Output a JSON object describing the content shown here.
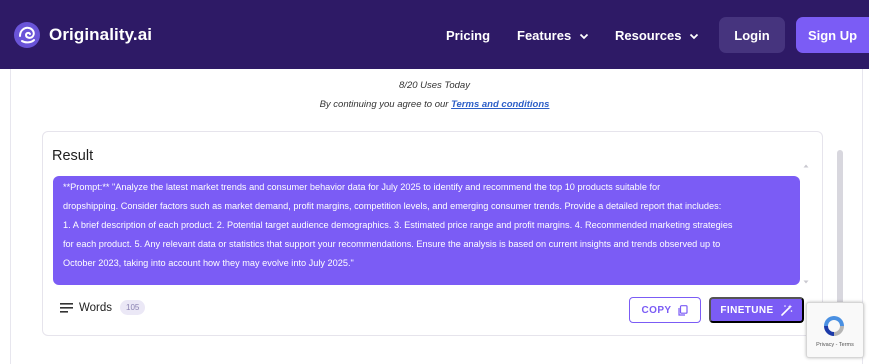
{
  "nav": {
    "brand": "Originality.ai",
    "links": [
      {
        "label": "Pricing"
      },
      {
        "label": "Features"
      },
      {
        "label": "Resources"
      }
    ],
    "login_label": "Login",
    "signup_label": "Sign Up"
  },
  "usage": {
    "uses_text": "8/20 Uses Today",
    "terms_prefix": "By continuing you agree to our ",
    "terms_link": "Terms and conditions"
  },
  "result": {
    "title": "Result",
    "prompt_lines": [
      "**Prompt:** \"Analyze the latest market trends and consumer behavior data for July 2025 to identify and recommend the top 10 products suitable for",
      "dropshipping. Consider factors such as market demand, profit margins, competition levels, and emerging consumer trends. Provide a detailed report that includes:",
      " 1. A brief description of each product. 2. Potential target audience demographics. 3. Estimated price range and profit margins. 4. Recommended marketing strategies",
      "for each product. 5. Any relevant data or statistics that support your recommendations.  Ensure the analysis is based on current insights and trends observed up to",
      "October 2023, taking into account how they may evolve into July 2025.\""
    ],
    "words_label": "Words",
    "word_count": "105",
    "copy_label": "COPY",
    "finetune_label": "FINETUNE"
  },
  "recaptcha": {
    "text": "Privacy - Terms"
  },
  "colors": {
    "nav_bg": "#2e1a66",
    "accent": "#7b5cf5",
    "login_bg": "#46347e"
  }
}
